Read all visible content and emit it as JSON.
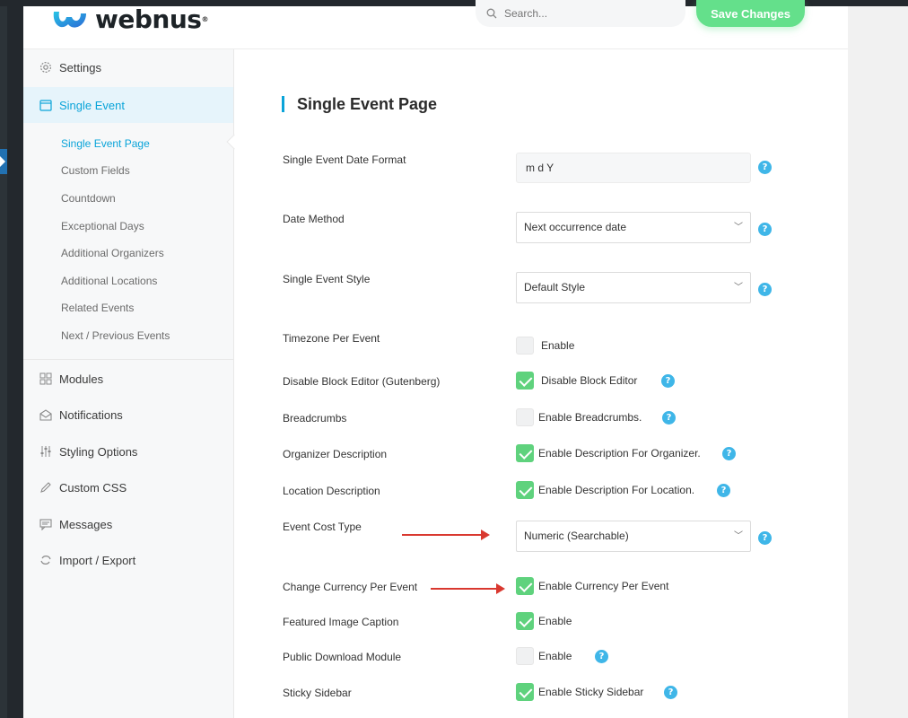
{
  "header": {
    "logo_text": "webnus",
    "logo_reg": "®",
    "search_placeholder": "Search...",
    "save_label": "Save Changes"
  },
  "sidebar": {
    "items": [
      {
        "label": "Settings",
        "icon": "gear-icon"
      },
      {
        "label": "Single Event",
        "icon": "calendar-icon"
      },
      {
        "label": "Modules",
        "icon": "grid-icon"
      },
      {
        "label": "Notifications",
        "icon": "envelope-icon"
      },
      {
        "label": "Styling Options",
        "icon": "sliders-icon"
      },
      {
        "label": "Custom CSS",
        "icon": "pencil-icon"
      },
      {
        "label": "Messages",
        "icon": "message-icon"
      },
      {
        "label": "Import / Export",
        "icon": "sync-icon"
      }
    ],
    "subitems": [
      "Single Event Page",
      "Custom Fields",
      "Countdown",
      "Exceptional Days",
      "Additional Organizers",
      "Additional Locations",
      "Related Events",
      "Next / Previous Events"
    ]
  },
  "main": {
    "title": "Single Event Page",
    "date_format": {
      "label": "Single Event Date Format",
      "value": "m d Y"
    },
    "date_method": {
      "label": "Date Method",
      "value": "Next occurrence date"
    },
    "event_style": {
      "label": "Single Event Style",
      "value": "Default Style"
    },
    "timezone": {
      "label": "Timezone Per Event",
      "option": "Enable",
      "checked": false
    },
    "block_editor": {
      "label": "Disable Block Editor (Gutenberg)",
      "option": "Disable Block Editor",
      "checked": true
    },
    "breadcrumbs": {
      "label": "Breadcrumbs",
      "option": "Enable Breadcrumbs.",
      "checked": false
    },
    "org_desc": {
      "label": "Organizer Description",
      "option": "Enable Description For Organizer.",
      "checked": true
    },
    "loc_desc": {
      "label": "Location Description",
      "option": "Enable Description For Location.",
      "checked": true
    },
    "cost_type": {
      "label": "Event Cost Type",
      "value": "Numeric (Searchable)"
    },
    "currency": {
      "label": "Change Currency Per Event",
      "option": "Enable Currency Per Event",
      "checked": true
    },
    "image_caption": {
      "label": "Featured Image Caption",
      "option": "Enable",
      "checked": true
    },
    "download": {
      "label": "Public Download Module",
      "option": "Enable",
      "checked": false
    },
    "sticky": {
      "label": "Sticky Sidebar",
      "option": "Enable Sticky Sidebar",
      "checked": true
    },
    "help_glyph": "?",
    "chevron_glyph": "﹀"
  },
  "colors": {
    "accent": "#0aa4d9",
    "save": "#64e08b",
    "check": "#5fd27d",
    "help": "#3fb6e8",
    "arrow": "#d9382f"
  }
}
